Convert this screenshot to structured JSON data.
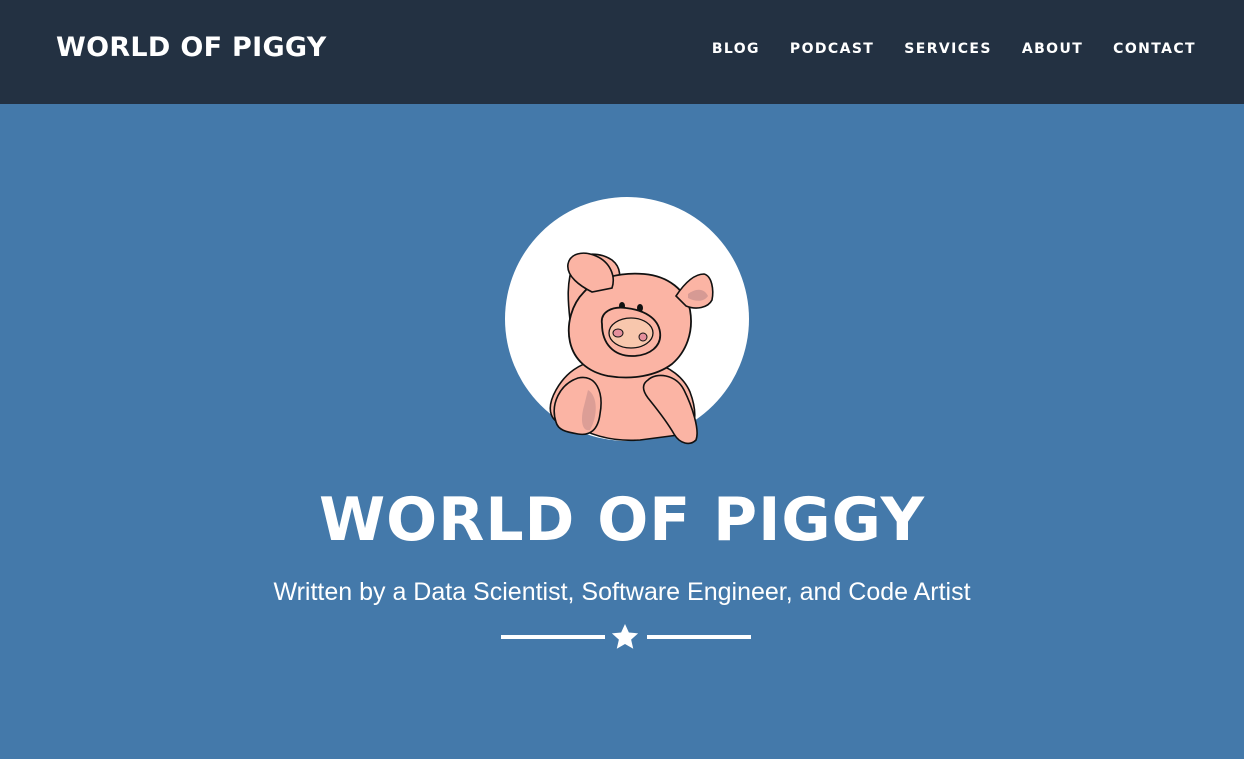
{
  "colors": {
    "nav_bg": "#233142",
    "hero_bg": "#4479aa",
    "text": "#ffffff",
    "pig_pink": "#fbb4a4"
  },
  "nav": {
    "brand": "WORLD OF PIGGY",
    "links": [
      "BLOG",
      "PODCAST",
      "SERVICES",
      "ABOUT",
      "CONTACT"
    ]
  },
  "hero": {
    "avatar_icon": "pig-avatar-icon",
    "title": "WORLD OF PIGGY",
    "subtitle": "Written by a Data Scientist, Software Engineer, and Code Artist",
    "divider_icon": "star-icon"
  }
}
